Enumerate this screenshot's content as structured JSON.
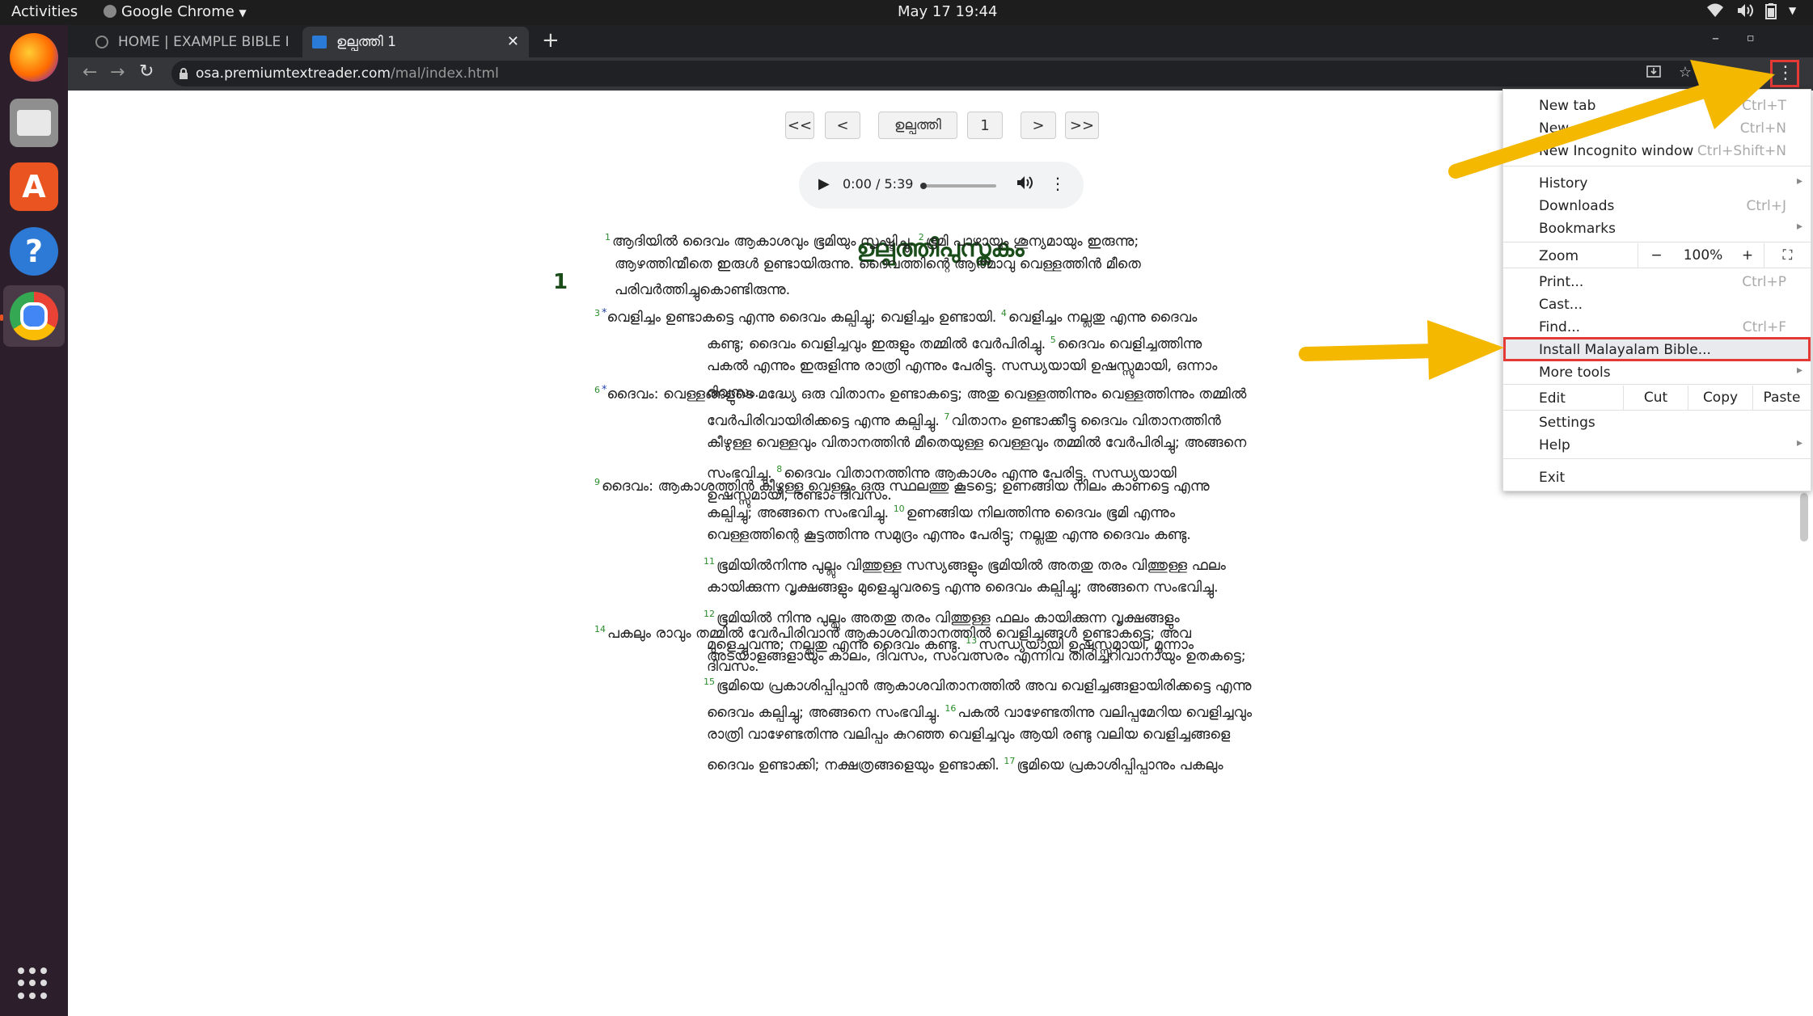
{
  "os": {
    "activities": "Activities",
    "app_name": "Google Chrome",
    "clock": "May 17  19:44"
  },
  "tabs": [
    {
      "label": "HOME | EXAMPLE BIBLE I"
    },
    {
      "label": "ഉല്പത്തി 1"
    }
  ],
  "address": {
    "host": "osa.premiumtextreader.com",
    "path": "/mal/index.html"
  },
  "reader_nav": {
    "first": "<<",
    "prev": "<",
    "book": "ഉല്പത്തി",
    "chapter": "1",
    "next": ">",
    "last": ">>"
  },
  "audio": {
    "time": "0:00 / 5:39"
  },
  "content": {
    "book_title": "ഉല്പത്തിപുസ്തകം",
    "chapter_number": "1",
    "paragraphs": [
      {
        "lines": [
          [
            {
              "vn": "1"
            },
            {
              "t": "ആദിയിൽ ദൈവം ആകാശവും ഭൂമിയും സൃഷ്ടിച്ചു. "
            },
            {
              "vn": "2"
            },
            {
              "t": "ഭൂമി പാഴായും ശൂന്യമായും ഇരുന്നു;"
            }
          ],
          [
            {
              "t": "ആഴത്തിന്മീതെ ഇരുൾ ഉണ്ടായിരുന്നു. ദൈവത്തിന്റെ ആത്മാവു വെള്ളത്തിൻ മീതെ"
            }
          ],
          [
            {
              "t": "പരിവർത്തിച്ചുകൊണ്ടിരുന്നു."
            }
          ]
        ]
      },
      {
        "lines": [
          [
            {
              "vn": "3"
            },
            {
              "st": "*"
            },
            {
              "t": "വെളിച്ചം ഉണ്ടാകട്ടെ എന്നു ദൈവം കല്പിച്ചു; വെളിച്ചം ഉണ്ടായി. "
            },
            {
              "vn": "4"
            },
            {
              "t": "വെളിച്ചം നല്ലതു എന്നു ദൈവം"
            }
          ],
          [
            {
              "t": "കണ്ടു; ദൈവം വെളിച്ചവും ഇരുളും തമ്മിൽ വേർപിരിച്ചു. "
            },
            {
              "vn": "5"
            },
            {
              "t": "ദൈവം വെളിച്ചത്തിന്നു"
            }
          ],
          [
            {
              "t": "പകൽ എന്നും ഇരുളിന്നു രാത്രി എന്നും പേരിട്ടു. സന്ധ്യയായി ഉഷസ്സുമായി, ഒന്നാം"
            }
          ],
          [
            {
              "t": "ദിവസം."
            }
          ]
        ]
      },
      {
        "lines": [
          [
            {
              "vn": "6"
            },
            {
              "st": "*"
            },
            {
              "t": "ദൈവം: വെള്ളങ്ങളുടെ മദ്ധ്യേ ഒരു വിതാനം ഉണ്ടാകട്ടെ; അതു വെള്ളത്തിന്നും വെള്ളത്തിന്നും തമ്മിൽ"
            }
          ],
          [
            {
              "t": "വേർപിരിവായിരിക്കട്ടെ എന്നു കല്പിച്ചു. "
            },
            {
              "vn": "7"
            },
            {
              "t": "വിതാനം ഉണ്ടാക്കീട്ടു ദൈവം വിതാനത്തിൻ"
            }
          ],
          [
            {
              "t": "കീഴുള്ള വെള്ളവും വിതാനത്തിൻ മീതെയുള്ള വെള്ളവും തമ്മിൽ വേർപിരിച്ചു; അങ്ങനെ"
            }
          ],
          [
            {
              "t": "സംഭവിച്ചു. "
            },
            {
              "vn": "8"
            },
            {
              "t": "ദൈവം വിതാനത്തിന്നു ആകാശം എന്നു പേരിട്ടു. സന്ധ്യയായി"
            }
          ],
          [
            {
              "t": "ഉഷസ്സുമായി, രണ്ടാം ദിവസം."
            }
          ]
        ]
      },
      {
        "lines": [
          [
            {
              "vn": "9"
            },
            {
              "t": "ദൈവം: ആകാശത്തിൻ കീഴുള്ള വെള്ളം ഒരു സ്ഥലത്തു കൂടട്ടെ; ഉണങ്ങിയ നിലം കാണട്ടെ എന്നു"
            }
          ],
          [
            {
              "t": "കല്പിച്ചു; അങ്ങനെ സംഭവിച്ചു. "
            },
            {
              "vn": "10"
            },
            {
              "t": "ഉണങ്ങിയ നിലത്തിന്നു ദൈവം ഭൂമി എന്നും"
            }
          ],
          [
            {
              "t": "വെള്ളത്തിന്റെ കൂട്ടത്തിന്നു സമുദ്രം എന്നും പേരിട്ടു; നല്ലതു എന്നു ദൈവം കണ്ടു."
            }
          ],
          [
            {
              "vn": "11"
            },
            {
              "t": "ഭൂമിയിൽനിന്നു പുല്ലും വിത്തുള്ള സസ്യങ്ങളും ഭൂമിയിൽ അതതു തരം വിത്തുള്ള ഫലം"
            }
          ],
          [
            {
              "t": "കായിക്കുന്ന വൃക്ഷങ്ങളും മുളെച്ചുവരട്ടെ എന്നു ദൈവം കല്പിച്ചു; അങ്ങനെ സംഭവിച്ചു."
            }
          ],
          [
            {
              "vn": "12"
            },
            {
              "t": "ഭൂമിയിൽ നിന്നു പുല്ലും അതതു തരം വിത്തുള്ള ഫലം കായിക്കുന്ന വൃക്ഷങ്ങളും"
            }
          ],
          [
            {
              "t": "മുളെച്ചുവന്നു; നല്ലതു എന്നു ദൈവം കണ്ടു. "
            },
            {
              "vn": "13"
            },
            {
              "t": "സന്ധ്യയായി ഉഷസ്സുമായി, മൂന്നാം"
            }
          ],
          [
            {
              "t": "ദിവസം."
            }
          ]
        ]
      },
      {
        "lines": [
          [
            {
              "vn": "14"
            },
            {
              "t": "പകലും രാവും തമ്മിൽ വേർപിരിവാൻ ആകാശവിതാനത്തിൽ വെളിച്ചങ്ങൾ ഉണ്ടാകട്ടെ; അവ"
            }
          ],
          [
            {
              "t": "അടയാളങ്ങളായും കാലം, ദിവസം, സംവത്സരം എന്നിവ തിരിച്ചറിവാനായും ഉതകട്ടെ;"
            }
          ],
          [
            {
              "vn": "15"
            },
            {
              "t": "ഭൂമിയെ പ്രകാശിപ്പിപ്പാൻ ആകാശവിതാനത്തിൽ അവ വെളിച്ചങ്ങളായിരിക്കട്ടെ എന്നു"
            }
          ],
          [
            {
              "t": "ദൈവം കല്പിച്ചു; അങ്ങനെ സംഭവിച്ചു. "
            },
            {
              "vn": "16"
            },
            {
              "t": "പകൽ വാഴേണ്ടതിന്നു വലിപ്പമേറിയ വെളിച്ചവും"
            }
          ],
          [
            {
              "t": "രാത്രി വാഴേണ്ടതിന്നു വലിപ്പം കുറഞ്ഞ വെളിച്ചവും ആയി രണ്ടു വലിയ വെളിച്ചങ്ങളെ"
            }
          ],
          [
            {
              "t": "ദൈവം ഉണ്ടാക്കി; നക്ഷത്രങ്ങളെയും ഉണ്ടാക്കി. "
            },
            {
              "vn": "17"
            },
            {
              "t": "ഭൂമിയെ പ്രകാശിപ്പിപ്പാനും പകലും"
            }
          ]
        ]
      }
    ]
  },
  "menu": {
    "new_tab": "New tab",
    "new_tab_sc": "Ctrl+T",
    "new_window": "New",
    "new_window_sc": "Ctrl+N",
    "incognito": "New Incognito window",
    "incognito_sc": "Ctrl+Shift+N",
    "history": "History",
    "downloads": "Downloads",
    "downloads_sc": "Ctrl+J",
    "bookmarks": "Bookmarks",
    "zoom": "Zoom",
    "zoom_minus": "−",
    "zoom_level": "100%",
    "zoom_plus": "+",
    "print": "Print...",
    "print_sc": "Ctrl+P",
    "cast": "Cast...",
    "find": "Find...",
    "find_sc": "Ctrl+F",
    "install": "Install Malayalam Bible...",
    "more_tools": "More tools",
    "edit": "Edit",
    "cut": "Cut",
    "copy": "Copy",
    "paste": "Paste",
    "settings": "Settings",
    "help": "Help",
    "exit": "Exit"
  },
  "colors": {
    "accent": "#f5b800",
    "highlight_box": "#e53935",
    "verse_number": "#2a8c2a",
    "title": "#1a4d1a"
  }
}
